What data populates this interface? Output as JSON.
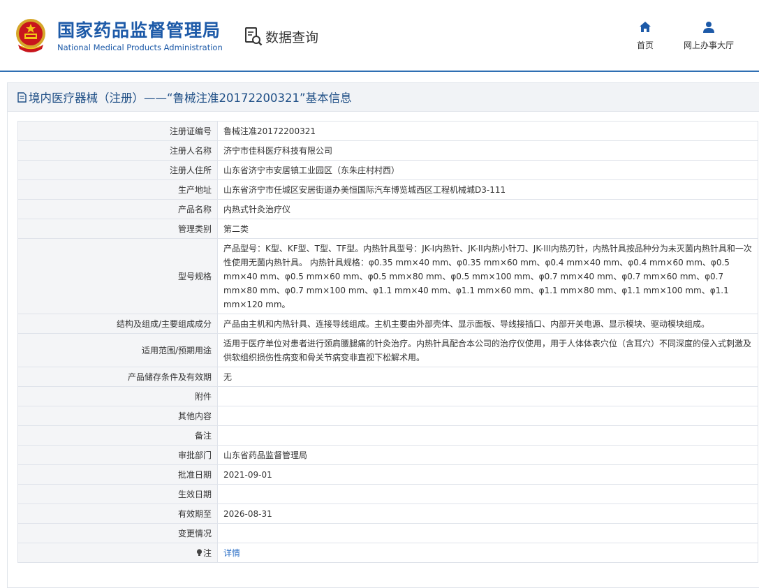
{
  "header": {
    "org_cn": "国家药品监督管理局",
    "org_en": "National Medical Products Administration",
    "query_label": "数据查询",
    "nav": [
      {
        "label": "首页",
        "icon": "home-icon"
      },
      {
        "label": "网上办事大厅",
        "icon": "user-icon"
      }
    ]
  },
  "panel": {
    "title": "境内医疗器械（注册）——“鲁械注准20172200321”基本信息",
    "rows": [
      {
        "key": "注册证编号",
        "value": "鲁械注准20172200321"
      },
      {
        "key": "注册人名称",
        "value": "济宁市佳科医疗科技有限公司"
      },
      {
        "key": "注册人住所",
        "value": "山东省济宁市安居镇工业园区（东朱庄村村西）"
      },
      {
        "key": "生产地址",
        "value": "山东省济宁市任城区安居街道办美恒国际汽车博览城西区工程机械城D3-111"
      },
      {
        "key": "产品名称",
        "value": "内热式针灸治疗仪"
      },
      {
        "key": "管理类别",
        "value": "第二类"
      },
      {
        "key": "型号规格",
        "value": "产品型号：K型、KF型、T型、TF型。内热针具型号：JK-I内热针、JK-II内热小针刀、JK-III内热刃针，内热针具按品种分为未灭菌内热针具和一次性使用无菌内热针具。 内热针具规格：φ0.35 mm×40 mm、φ0.35 mm×60 mm、φ0.4 mm×40 mm、φ0.4 mm×60 mm、φ0.5 mm×40 mm、φ0.5 mm×60 mm、φ0.5 mm×80 mm、φ0.5 mm×100 mm、φ0.7 mm×40 mm、φ0.7 mm×60 mm、φ0.7 mm×80 mm、φ0.7 mm×100 mm、φ1.1 mm×40 mm、φ1.1 mm×60 mm、φ1.1 mm×80 mm、φ1.1 mm×100 mm、φ1.1 mm×120 mm。"
      },
      {
        "key": "结构及组成/主要组成成分",
        "value": "产品由主机和内热针具、连接导线组成。主机主要由外部壳体、显示面板、导线接插口、内部开关电源、显示模块、驱动模块组成。"
      },
      {
        "key": "适用范围/预期用途",
        "value": "适用于医疗单位对患者进行颈肩腰腿痛的针灸治疗。内热针具配合本公司的治疗仪使用，用于人体体表穴位（含耳穴）不同深度的侵入式刺激及供软组织损伤性病变和骨关节病变非直视下松解术用。"
      },
      {
        "key": "产品储存条件及有效期",
        "value": "无"
      },
      {
        "key": "附件",
        "value": ""
      },
      {
        "key": "其他内容",
        "value": ""
      },
      {
        "key": "备注",
        "value": ""
      },
      {
        "key": "审批部门",
        "value": "山东省药品监督管理局"
      },
      {
        "key": "批准日期",
        "value": "2021-09-01"
      },
      {
        "key": "生效日期",
        "value": ""
      },
      {
        "key": "有效期至",
        "value": "2026-08-31"
      },
      {
        "key": "变更情况",
        "value": ""
      },
      {
        "key": "注",
        "value": "详情",
        "icon": "info-bulb-icon"
      }
    ]
  }
}
